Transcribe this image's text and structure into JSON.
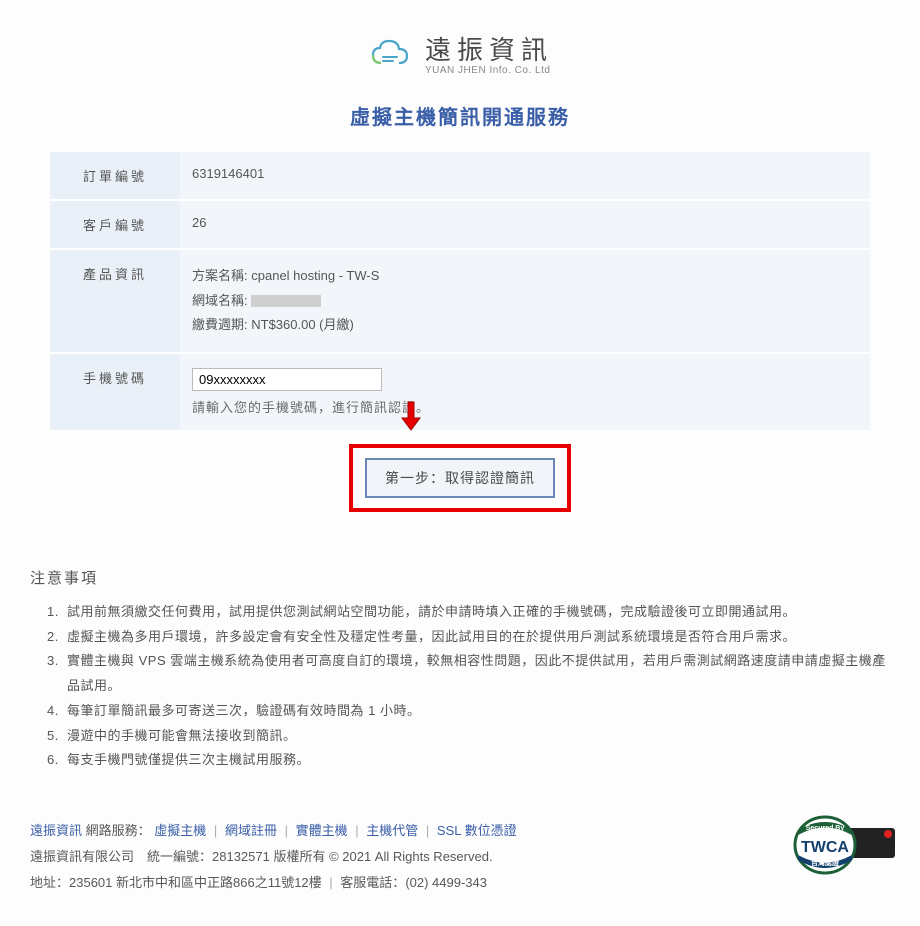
{
  "logo": {
    "cn": "遠振資訊",
    "en": "YUAN JHEN Info. Co. Ltd"
  },
  "page_title": "虛擬主機簡訊開通服務",
  "rows": {
    "order_label": "訂單編號",
    "order_value": "6319146401",
    "cust_label": "客戶編號",
    "cust_value": "26",
    "prod_label": "產品資訊",
    "prod_plan_label": "方案名稱:",
    "prod_plan_value": "cpanel hosting - TW-S",
    "prod_domain_label": "網域名稱:",
    "prod_cycle_label": "繳費週期:",
    "prod_cycle_value": "NT$360.00 (月繳)",
    "phone_label": "手機號碼",
    "phone_value": "09xxxxxxxx",
    "phone_hint": "請輸入您的手機號碼，進行簡訊認證。"
  },
  "step_button": "第一步：取得認證簡訊",
  "notice_heading": "注意事項",
  "notices": [
    "試用前無須繳交任何費用，試用提供您測試網站空間功能，請於申請時填入正確的手機號碼，完成驗證後可立即開通試用。",
    "虛擬主機為多用戶環境，許多設定會有安全性及穩定性考量，因此試用目的在於提供用戶測試系統環境是否符合用戶需求。",
    "實體主機與 VPS 雲端主機系統為使用者可高度自訂的環境，較無相容性問題，因此不提供試用，若用戶需測試網路速度請申請虛擬主機產品試用。",
    "每筆訂單簡訊最多可寄送三次，驗證碼有效時間為 1 小時。",
    "漫遊中的手機可能會無法接收到簡訊。",
    "每支手機門號僅提供三次主機試用服務。"
  ],
  "footer": {
    "brand": "遠振資訊",
    "svc_label": "網路服務：",
    "links": [
      "虛擬主機",
      "網域註冊",
      "實體主機",
      "主機代管",
      "SSL 數位憑證"
    ],
    "company_line": "遠振資訊有限公司　統一編號：28132571  版權所有 © 2021 All Rights Reserved.",
    "addr_label": "地址：",
    "addr_value": "235601 新北市中和區中正路866之11號12樓",
    "tel_label": "客服電話：",
    "tel_value": "(02) 4499-343"
  }
}
